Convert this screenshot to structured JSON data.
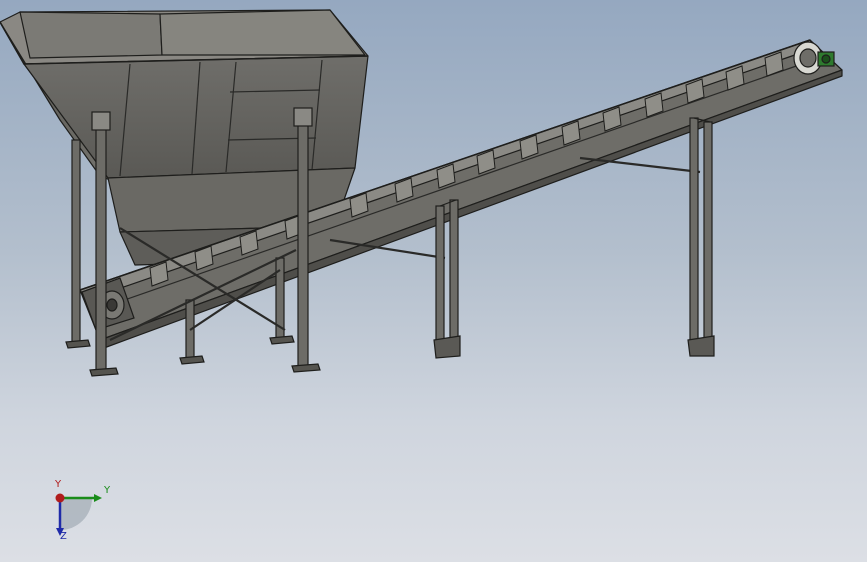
{
  "viewport": {
    "name": "graphics-area"
  },
  "model": {
    "parts": [
      "hopper",
      "hopper-legs",
      "cross-braces",
      "inclined-conveyor",
      "conveyor-rollers",
      "head-pulley",
      "drive-motor",
      "support-frame-middle",
      "support-frame-rear"
    ]
  },
  "triad": {
    "axis_top_label": "Y",
    "axis_right_label": "Y",
    "axis_down_label": "Z",
    "colors": {
      "red": "#b01c1c",
      "green": "#1a8c1a",
      "blue": "#1f2aa8"
    }
  }
}
